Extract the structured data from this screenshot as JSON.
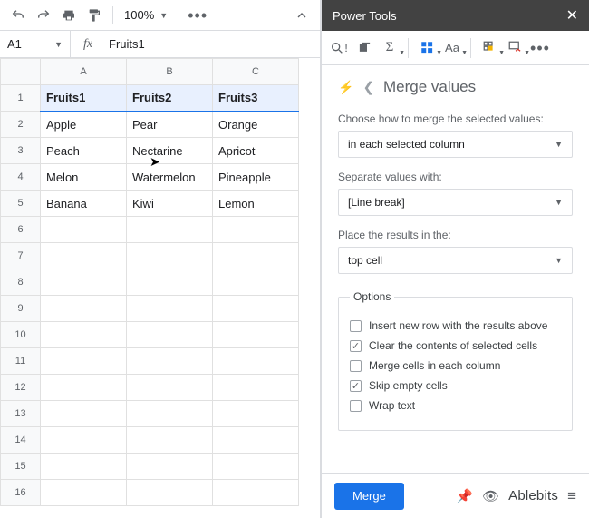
{
  "toolbar": {
    "zoom": "100%"
  },
  "formula": {
    "namebox": "A1",
    "value": "Fruits1"
  },
  "columns": [
    "A",
    "B",
    "C"
  ],
  "rows": [
    {
      "n": 1,
      "cells": [
        "Fruits1",
        "Fruits2",
        "Fruits3"
      ],
      "header": true
    },
    {
      "n": 2,
      "cells": [
        "Apple",
        "Pear",
        "Orange"
      ]
    },
    {
      "n": 3,
      "cells": [
        "Peach",
        "Nectarine",
        "Apricot"
      ]
    },
    {
      "n": 4,
      "cells": [
        "Melon",
        "Watermelon",
        "Pineapple"
      ]
    },
    {
      "n": 5,
      "cells": [
        "Banana",
        "Kiwi",
        "Lemon"
      ]
    },
    {
      "n": 6,
      "cells": [
        "",
        "",
        ""
      ]
    },
    {
      "n": 7,
      "cells": [
        "",
        "",
        ""
      ]
    },
    {
      "n": 8,
      "cells": [
        "",
        "",
        ""
      ]
    },
    {
      "n": 9,
      "cells": [
        "",
        "",
        ""
      ]
    },
    {
      "n": 10,
      "cells": [
        "",
        "",
        ""
      ]
    },
    {
      "n": 11,
      "cells": [
        "",
        "",
        ""
      ]
    },
    {
      "n": 12,
      "cells": [
        "",
        "",
        ""
      ]
    },
    {
      "n": 13,
      "cells": [
        "",
        "",
        ""
      ]
    },
    {
      "n": 14,
      "cells": [
        "",
        "",
        ""
      ]
    },
    {
      "n": 15,
      "cells": [
        "",
        "",
        ""
      ]
    },
    {
      "n": 16,
      "cells": [
        "",
        "",
        ""
      ]
    }
  ],
  "panel": {
    "title": "Power Tools",
    "crumb": "Merge values",
    "fields": {
      "howLabel": "Choose how to merge the selected values:",
      "howValue": "in each selected column",
      "sepLabel": "Separate values with:",
      "sepValue": "[Line break]",
      "placeLabel": "Place the results in the:",
      "placeValue": "top cell"
    },
    "optionsLegend": "Options",
    "options": [
      {
        "label": "Insert new row with the results above",
        "checked": false
      },
      {
        "label": "Clear the contents of selected cells",
        "checked": true
      },
      {
        "label": "Merge cells in each column",
        "checked": false
      },
      {
        "label": "Skip empty cells",
        "checked": true
      },
      {
        "label": "Wrap text",
        "checked": false
      }
    ],
    "mergeButton": "Merge",
    "brand": "Ablebits"
  }
}
